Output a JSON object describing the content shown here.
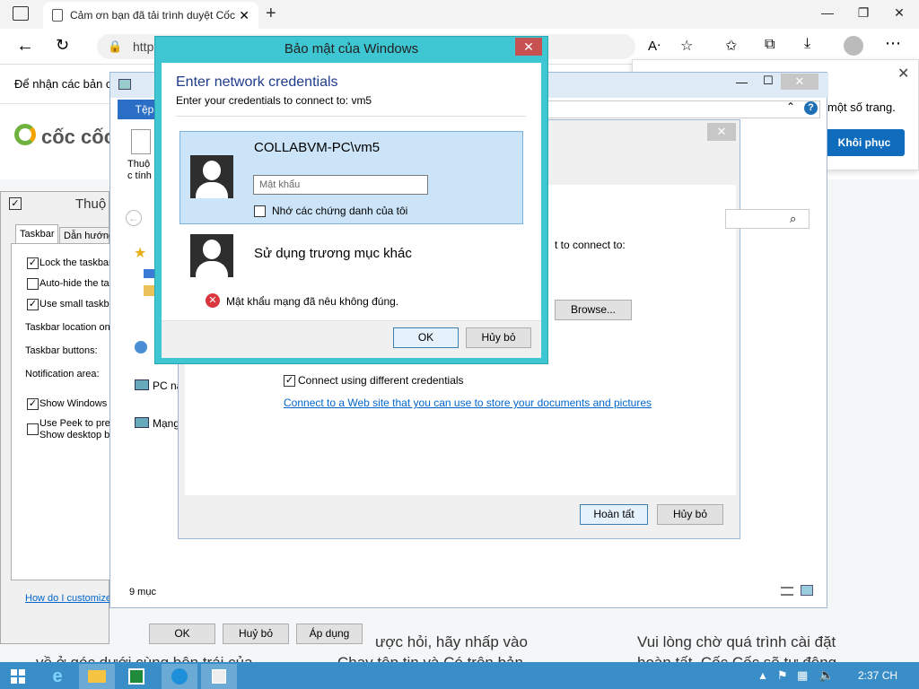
{
  "browser": {
    "tab_title": "Cảm ơn bạn đã tải trình duyệt Cốc Cốc",
    "url": "http",
    "notification_text": "Để nhận các bản c",
    "restore_hint": "một số trang.",
    "restore_button": "Khôi phục",
    "logo_text": "cốc cốc",
    "page_text_1": "ược hỏi, hãy nhấp vào",
    "page_text_2": "Vui lòng chờ quá trình cài đặt",
    "page_text_3": "hoàn tất. Cốc Cốc sẽ tự động",
    "page_text_4": "Chạy tệp tin và Có trên bản",
    "page_text_5": "về ở góc dưới cùng bên trái của"
  },
  "taskbar_props": {
    "title": "Thuộ",
    "tabs": [
      "Taskbar",
      "Dẫn hướng"
    ],
    "options": [
      {
        "label": "Lock the taskbar",
        "checked": true
      },
      {
        "label": "Auto-hide the ta",
        "checked": false
      },
      {
        "label": "Use small taskba",
        "checked": true
      }
    ],
    "location_label": "Taskbar location on",
    "buttons_label": "Taskbar buttons:",
    "notification_label": "Notification area:",
    "show_windows": "Show Windows S",
    "peek_1": "Use Peek to prev",
    "peek_2": "Show desktop bu",
    "help_link": "How do I customize",
    "ok": "OK",
    "cancel": "Huỷ bỏ",
    "apply": "Áp dụng"
  },
  "explorer": {
    "file_tab": "Tệp",
    "prop_label_1": "Thuộ",
    "prop_label_2": "c tính",
    "pc_label": "PC na",
    "network_label": "Mạng",
    "item_count": "9 mục"
  },
  "wizard": {
    "connect_to": "t to connect to:",
    "browse": "Browse...",
    "connect_diff": "Connect using different credentials",
    "link_text": "Connect to a Web site that you can use to store your documents and pictures",
    "finish": "Hoàn tất",
    "cancel": "Hủy bỏ"
  },
  "security": {
    "title": "Bảo mật của Windows",
    "heading": "Enter network credentials",
    "subheading": "Enter your credentials to connect to: vm5",
    "account": "COLLABVM-PC\\vm5",
    "password_placeholder": "Mật khẩu",
    "remember": "Nhớ các chứng danh của tôi",
    "other_account": "Sử dụng trương mục khác",
    "error": "Mật khẩu mạng đã nêu không đúng.",
    "ok": "OK",
    "cancel": "Hủy bỏ"
  },
  "system": {
    "clock": "2:37 CH"
  }
}
